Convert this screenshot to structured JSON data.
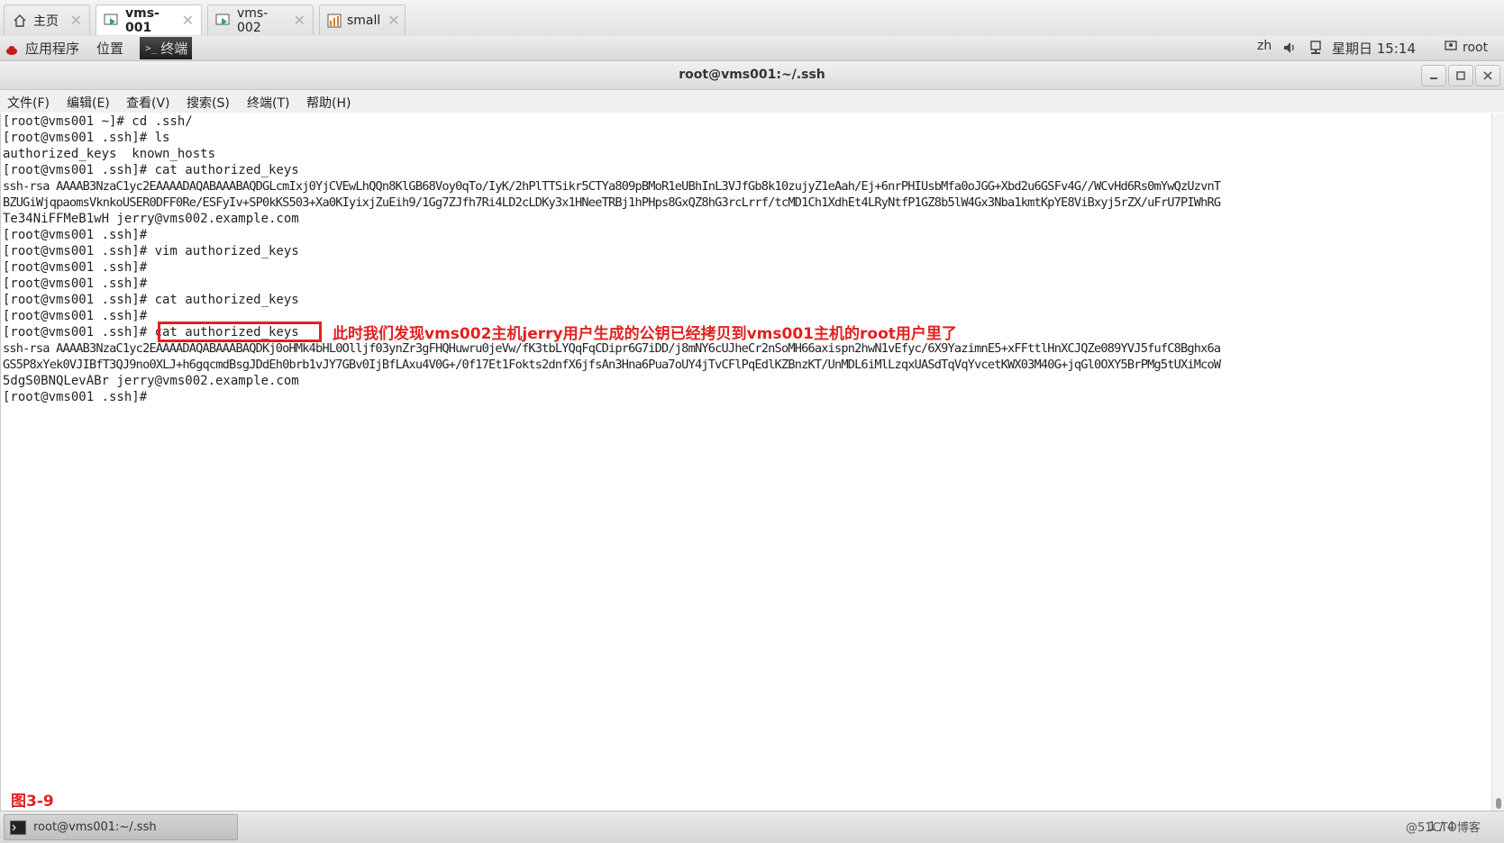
{
  "tabs": [
    {
      "label": "主页",
      "icon": "home-icon"
    },
    {
      "label": "vms-001",
      "icon": "vm-icon"
    },
    {
      "label": "vms-002",
      "icon": "vm-icon"
    },
    {
      "label": "small",
      "icon": "chart-icon"
    }
  ],
  "panel": {
    "apps_label": "应用程序",
    "places_label": "位置",
    "terminal_label": "终端",
    "lang": "zh",
    "datetime": "星期日 15:14",
    "user": "root"
  },
  "window": {
    "title": "root@vms001:~/.ssh"
  },
  "menu": [
    "文件(F)",
    "编辑(E)",
    "查看(V)",
    "搜索(S)",
    "终端(T)",
    "帮助(H)"
  ],
  "terminal_lines": [
    "[root@vms001 ~]# cd .ssh/",
    "[root@vms001 .ssh]# ls",
    "authorized_keys  known_hosts",
    "[root@vms001 .ssh]# cat authorized_keys",
    "ssh-rsa AAAAB3NzaC1yc2EAAAADAQABAAABAQDGLcmIxj0YjCVEwLhQQn8KlGB68Voy0qTo/IyK/2hPlTTSikr5CTYa809pBMoR1eUBhInL3VJfGb8k10zujyZ1eAah/Ej+6nrPHIUsbMfa0oJGG+Xbd2u6GSFv4G//WCvHd6Rs0mYwQzUzvnT",
    "BZUGiWjqpaomsVknkoUSER0DFF0Re/ESFyIv+SP0kKS503+Xa0KIyixjZuEih9/1Gg7ZJfh7Ri4LD2cLDKy3x1HNeeTRBj1hPHps8GxQZ8hG3rcLrrf/tcMD1Ch1XdhEt4LRyNtfP1GZ8b5lW4Gx3Nba1kmtKpYE8ViBxyj5rZX/uFrU7PIWhRG",
    "Te34NiFFMeB1wH jerry@vms002.example.com",
    "[root@vms001 .ssh]#",
    "[root@vms001 .ssh]# vim authorized_keys",
    "[root@vms001 .ssh]#",
    "[root@vms001 .ssh]#",
    "[root@vms001 .ssh]# cat authorized_keys",
    "[root@vms001 .ssh]#",
    "[root@vms001 .ssh]# cat authorized_keys",
    "ssh-rsa AAAAB3NzaC1yc2EAAAADAQABAAABAQDKj0oHMk4bHL0Olljf03ynZr3gFHQHuwru0jeVw/fK3tbLYQqFqCDipr6G7iDD/j8mNY6cUJheCr2nSoMH66axispn2hwN1vEfyc/6X9YazimnE5+xFFttlHnXCJQZe089YVJ5fufC8Bghx6a",
    "GS5P8xYek0VJIBfT3QJ9no0XLJ+h6gqcmdBsgJDdEh0brb1vJY7GBv0IjBfLAxu4V0G+/0f17Et1Fokts2dnfX6jfsAn3Hna6Pua7oUY4jTvCFlPqEdlKZBnzKT/UnMDL6iMlLzqxUASdTqVqYvcetKWX03M40G+jqGl0OXY5BrPMg5tUXiMcoW",
    "5dgS0BNQLevABr jerry@vms002.example.com",
    "[root@vms001 .ssh]#"
  ],
  "annotation": "此时我们发现vms002主机jerry用户生成的公钥已经拷贝到vms001主机的root用户里了",
  "figure_label": "图3-9",
  "taskbar": {
    "item_label": "root@vms001:~/.ssh",
    "pager": "1 / 4"
  },
  "watermark": "@51CTO博客",
  "colors": {
    "annotation_red": "#e32020",
    "terminal_bg": "#ffffff"
  }
}
